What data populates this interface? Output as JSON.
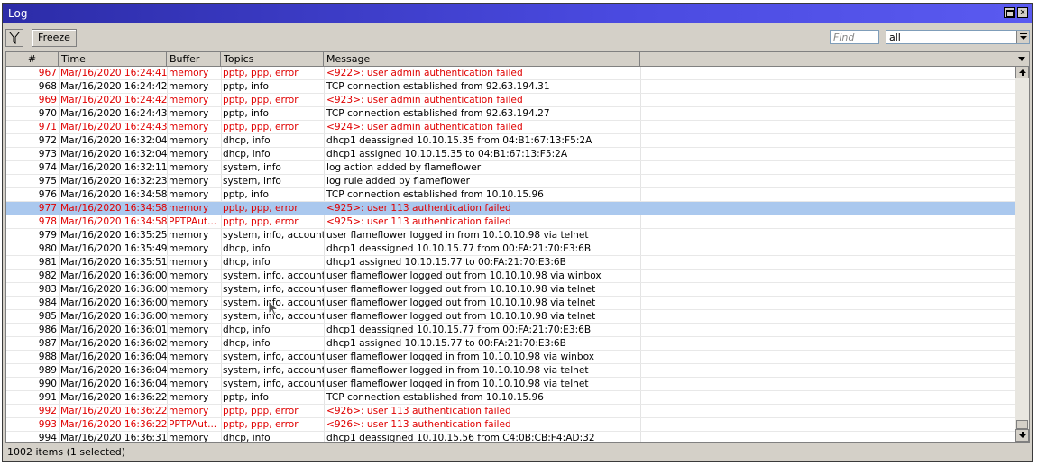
{
  "window": {
    "title": "Log"
  },
  "toolbar": {
    "freeze_label": "Freeze",
    "find_placeholder": "Find",
    "filter_value": "all"
  },
  "columns": [
    "#",
    "Time",
    "Buffer",
    "Topics",
    "Message"
  ],
  "rows": [
    {
      "num": "967",
      "time": "Mar/16/2020 16:24:41",
      "buffer": "memory",
      "topics": "pptp, ppp, error",
      "message": "<922>: user admin authentication failed",
      "err": true
    },
    {
      "num": "968",
      "time": "Mar/16/2020 16:24:42",
      "buffer": "memory",
      "topics": "pptp, info",
      "message": "TCP connection established from 92.63.194.31",
      "err": false
    },
    {
      "num": "969",
      "time": "Mar/16/2020 16:24:42",
      "buffer": "memory",
      "topics": "pptp, ppp, error",
      "message": "<923>: user admin authentication failed",
      "err": true
    },
    {
      "num": "970",
      "time": "Mar/16/2020 16:24:43",
      "buffer": "memory",
      "topics": "pptp, info",
      "message": "TCP connection established from 92.63.194.27",
      "err": false
    },
    {
      "num": "971",
      "time": "Mar/16/2020 16:24:43",
      "buffer": "memory",
      "topics": "pptp, ppp, error",
      "message": "<924>: user admin authentication failed",
      "err": true
    },
    {
      "num": "972",
      "time": "Mar/16/2020 16:32:04",
      "buffer": "memory",
      "topics": "dhcp, info",
      "message": "dhcp1 deassigned 10.10.15.35 from 04:B1:67:13:F5:2A",
      "err": false
    },
    {
      "num": "973",
      "time": "Mar/16/2020 16:32:04",
      "buffer": "memory",
      "topics": "dhcp, info",
      "message": "dhcp1 assigned 10.10.15.35 to 04:B1:67:13:F5:2A",
      "err": false
    },
    {
      "num": "974",
      "time": "Mar/16/2020 16:32:11",
      "buffer": "memory",
      "topics": "system, info",
      "message": "log action added by flameflower",
      "err": false
    },
    {
      "num": "975",
      "time": "Mar/16/2020 16:32:23",
      "buffer": "memory",
      "topics": "system, info",
      "message": "log rule added by flameflower",
      "err": false
    },
    {
      "num": "976",
      "time": "Mar/16/2020 16:34:58",
      "buffer": "memory",
      "topics": "pptp, info",
      "message": "TCP connection established from 10.10.15.96",
      "err": false
    },
    {
      "num": "977",
      "time": "Mar/16/2020 16:34:58",
      "buffer": "memory",
      "topics": "pptp, ppp, error",
      "message": "<925>: user 113 authentication failed",
      "err": true,
      "selected": true
    },
    {
      "num": "978",
      "time": "Mar/16/2020 16:34:58",
      "buffer": "PPTPAut...",
      "topics": "pptp, ppp, error",
      "message": "<925>: user 113 authentication failed",
      "err": true
    },
    {
      "num": "979",
      "time": "Mar/16/2020 16:35:25",
      "buffer": "memory",
      "topics": "system, info, account",
      "message": "user flameflower logged in from 10.10.10.98 via telnet",
      "err": false
    },
    {
      "num": "980",
      "time": "Mar/16/2020 16:35:49",
      "buffer": "memory",
      "topics": "dhcp, info",
      "message": "dhcp1 deassigned 10.10.15.77 from 00:FA:21:70:E3:6B",
      "err": false
    },
    {
      "num": "981",
      "time": "Mar/16/2020 16:35:51",
      "buffer": "memory",
      "topics": "dhcp, info",
      "message": "dhcp1 assigned 10.10.15.77 to 00:FA:21:70:E3:6B",
      "err": false
    },
    {
      "num": "982",
      "time": "Mar/16/2020 16:36:00",
      "buffer": "memory",
      "topics": "system, info, account",
      "message": "user flameflower logged out from 10.10.10.98 via winbox",
      "err": false
    },
    {
      "num": "983",
      "time": "Mar/16/2020 16:36:00",
      "buffer": "memory",
      "topics": "system, info, account",
      "message": "user flameflower logged out from 10.10.10.98 via telnet",
      "err": false
    },
    {
      "num": "984",
      "time": "Mar/16/2020 16:36:00",
      "buffer": "memory",
      "topics": "system, info, account",
      "message": "user flameflower logged out from 10.10.10.98 via telnet",
      "err": false
    },
    {
      "num": "985",
      "time": "Mar/16/2020 16:36:00",
      "buffer": "memory",
      "topics": "system, info, account",
      "message": "user flameflower logged out from 10.10.10.98 via telnet",
      "err": false
    },
    {
      "num": "986",
      "time": "Mar/16/2020 16:36:01",
      "buffer": "memory",
      "topics": "dhcp, info",
      "message": "dhcp1 deassigned 10.10.15.77 from 00:FA:21:70:E3:6B",
      "err": false
    },
    {
      "num": "987",
      "time": "Mar/16/2020 16:36:02",
      "buffer": "memory",
      "topics": "dhcp, info",
      "message": "dhcp1 assigned 10.10.15.77 to 00:FA:21:70:E3:6B",
      "err": false
    },
    {
      "num": "988",
      "time": "Mar/16/2020 16:36:04",
      "buffer": "memory",
      "topics": "system, info, account",
      "message": "user flameflower logged in from 10.10.10.98 via winbox",
      "err": false
    },
    {
      "num": "989",
      "time": "Mar/16/2020 16:36:04",
      "buffer": "memory",
      "topics": "system, info, account",
      "message": "user flameflower logged in from 10.10.10.98 via telnet",
      "err": false
    },
    {
      "num": "990",
      "time": "Mar/16/2020 16:36:04",
      "buffer": "memory",
      "topics": "system, info, account",
      "message": "user flameflower logged in from 10.10.10.98 via telnet",
      "err": false
    },
    {
      "num": "991",
      "time": "Mar/16/2020 16:36:22",
      "buffer": "memory",
      "topics": "pptp, info",
      "message": "TCP connection established from 10.10.15.96",
      "err": false
    },
    {
      "num": "992",
      "time": "Mar/16/2020 16:36:22",
      "buffer": "memory",
      "topics": "pptp, ppp, error",
      "message": "<926>: user 113 authentication failed",
      "err": true
    },
    {
      "num": "993",
      "time": "Mar/16/2020 16:36:22",
      "buffer": "PPTPAut...",
      "topics": "pptp, ppp, error",
      "message": "<926>: user 113 authentication failed",
      "err": true
    },
    {
      "num": "994",
      "time": "Mar/16/2020 16:36:31",
      "buffer": "memory",
      "topics": "dhcp, info",
      "message": "dhcp1 deassigned 10.10.15.56 from C4:0B:CB:F4:AD:32",
      "err": false
    }
  ],
  "status": {
    "text": "1002 items (1 selected)"
  },
  "colors": {
    "error": "#e00000",
    "selected": "#aac8ee",
    "title_bar": "#2c2ca8"
  }
}
